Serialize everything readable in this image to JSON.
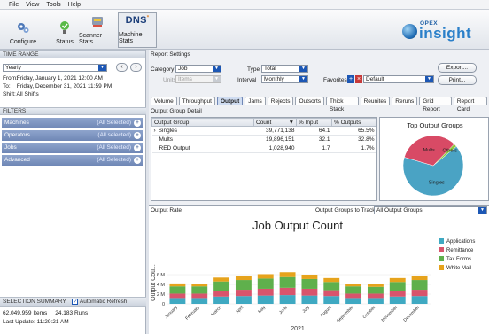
{
  "menu": [
    "File",
    "View",
    "Tools",
    "Help"
  ],
  "toolbar": {
    "buttons": [
      {
        "label": "Configure",
        "icon": "configure-icon"
      },
      {
        "label": "Status",
        "icon": "status-icon"
      },
      {
        "label": "Scanner Stats",
        "icon": "scanner-stats-icon"
      },
      {
        "label": "Machine Stats",
        "icon": "dns-logo",
        "logo_text": "DNS",
        "active": true
      }
    ],
    "brand_small": "OPEX",
    "brand_big": "insight"
  },
  "time_range": {
    "header": "TIME RANGE",
    "selected": "Yearly",
    "from_label": "From:",
    "from_value": "Friday, January 1, 2021 12:00 AM",
    "to_label": "To:",
    "to_value": "Friday, December 31, 2021 11:59 PM",
    "shift_label": "Shift:",
    "shift_value": "All Shifts"
  },
  "filters": {
    "header": "FILTERS",
    "rows": [
      {
        "label": "Machines",
        "value": "(All Selected)"
      },
      {
        "label": "Operators",
        "value": "(All selected)"
      },
      {
        "label": "Jobs",
        "value": "(All Selected)"
      },
      {
        "label": "Advanced",
        "value": "(All Selected)"
      }
    ]
  },
  "selection_summary": {
    "header": "SELECTION SUMMARY",
    "auto_refresh_label": "Automatic Refresh",
    "items": "62,049,959 Items",
    "runs": "24,183 Runs",
    "last_update": "Last Update: 11:29:21 AM"
  },
  "report_settings": {
    "header": "Report Settings",
    "category_label": "Category",
    "category_value": "Job",
    "units_label": "Units",
    "units_value": "Items",
    "type_label": "Type",
    "type_value": "Total",
    "interval_label": "Interval",
    "interval_value": "Monthly",
    "favorites_label": "Favorites",
    "favorites_value": "Default",
    "export_label": "Export...",
    "print_label": "Print..."
  },
  "tabs": [
    "Volume",
    "Throughput",
    "Output",
    "Jams",
    "Rejects",
    "Outsorts",
    "Thick Stack",
    "Reunites",
    "Reruns",
    "Grid Report",
    "Report Card"
  ],
  "active_tab": "Output",
  "output_group_detail": {
    "header": "Output Group Detail",
    "columns": [
      "Output Group",
      "Count",
      "% Input",
      "% Outputs"
    ],
    "rows": [
      [
        "Singles",
        "39,771,138",
        "64.1",
        "65.5%"
      ],
      [
        "Mults",
        "19,896,151",
        "32.1",
        "32.8%"
      ],
      [
        "RED Output",
        "1,028,940",
        "1.7",
        "1.7%"
      ]
    ]
  },
  "pie": {
    "title": "Top Output Groups",
    "labels": [
      "Singles",
      "Mults",
      "Others"
    ]
  },
  "output_rate": {
    "header": "Output Rate",
    "groups_label": "Output Groups to Track",
    "groups_value": "All Output Groups"
  },
  "chart_data": [
    {
      "type": "pie",
      "title": "Top Output Groups",
      "labels": [
        "Singles",
        "Mults",
        "Others"
      ],
      "values": [
        65.5,
        32.8,
        1.7
      ],
      "colors": [
        "#4aa3c4",
        "#d84a65",
        "#8dc63f"
      ]
    },
    {
      "type": "bar",
      "stacked": true,
      "title": "Job Output Count",
      "xlabel": "2021",
      "ylabel": "Output Cou...",
      "categories": [
        "January",
        "February",
        "March",
        "April",
        "May",
        "June",
        "July",
        "August",
        "September",
        "October",
        "November",
        "December"
      ],
      "series": [
        {
          "name": "Applications",
          "color": "#3fa9c2",
          "values": [
            1.2,
            1.2,
            1.5,
            1.6,
            1.7,
            1.8,
            1.7,
            1.6,
            1.2,
            1.2,
            1.5,
            1.6
          ]
        },
        {
          "name": "Remittance",
          "color": "#d8546c",
          "values": [
            0.9,
            0.9,
            1.2,
            1.3,
            1.4,
            1.5,
            1.4,
            1.2,
            0.9,
            0.9,
            1.2,
            1.3
          ]
        },
        {
          "name": "Tax Forms",
          "color": "#5fb04c",
          "values": [
            1.5,
            1.5,
            1.9,
            2.0,
            2.1,
            2.2,
            2.0,
            1.7,
            1.5,
            1.4,
            1.8,
            2.0
          ]
        },
        {
          "name": "White Mail",
          "color": "#e6a31c",
          "values": [
            0.6,
            0.5,
            0.8,
            0.9,
            0.9,
            1.0,
            0.9,
            0.8,
            0.5,
            0.6,
            0.8,
            0.9
          ]
        }
      ],
      "yticks": [
        "0",
        "2 M",
        "4 M",
        "6 M"
      ],
      "ylim": [
        0,
        8
      ],
      "legend": "right"
    }
  ]
}
